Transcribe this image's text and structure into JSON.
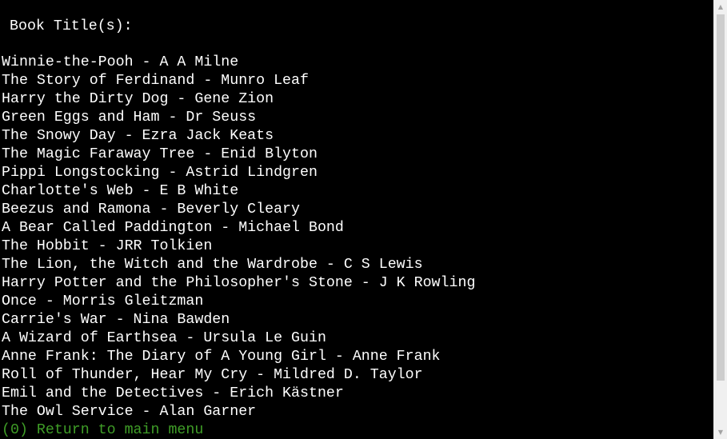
{
  "console": {
    "heading": "Book Title(s):",
    "books": [
      "Winnie-the-Pooh - A A Milne",
      "The Story of Ferdinand - Munro Leaf",
      "Harry the Dirty Dog - Gene Zion",
      "Green Eggs and Ham - Dr Seuss",
      "The Snowy Day - Ezra Jack Keats",
      "The Magic Faraway Tree - Enid Blyton",
      "Pippi Longstocking - Astrid Lindgren",
      "Charlotte's Web - E B White",
      "Beezus and Ramona - Beverly Cleary",
      "A Bear Called Paddington - Michael Bond",
      "The Hobbit - JRR Tolkien",
      "The Lion, the Witch and the Wardrobe - C S Lewis",
      "Harry Potter and the Philosopher's Stone - J K Rowling",
      "Once - Morris Gleitzman",
      "Carrie's War - Nina Bawden",
      "A Wizard of Earthsea - Ursula Le Guin",
      "Anne Frank: The Diary of A Young Girl - Anne Frank",
      "Roll of Thunder, Hear My Cry - Mildred D. Taylor",
      "Emil and the Detectives - Erich Kästner",
      "The Owl Service - Alan Garner"
    ],
    "menu_option": "(0) Return to main menu"
  },
  "colors": {
    "background": "#000000",
    "text": "#ffffff",
    "menu_option": "#3f9d27"
  },
  "scrollbar": {
    "up_icon": "scroll-up-arrow-icon",
    "down_icon": "scroll-down-arrow-icon"
  }
}
